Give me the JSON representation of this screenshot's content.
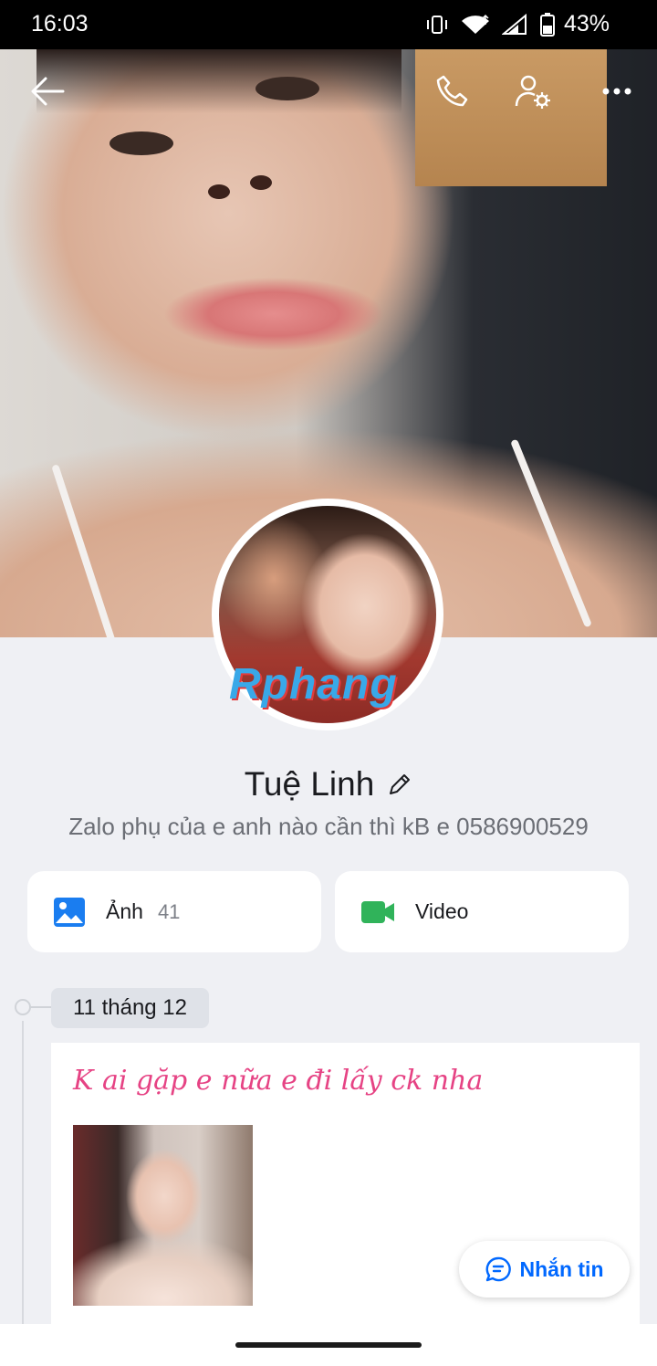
{
  "status_bar": {
    "time": "16:03",
    "battery": "43%",
    "icons": [
      "vibrate-icon",
      "wifi-icon",
      "signal-icon",
      "battery-icon"
    ]
  },
  "header": {
    "actions": [
      "back-icon",
      "phone-icon",
      "user-settings-icon",
      "more-icon"
    ]
  },
  "watermark": "Rphang",
  "profile": {
    "name": "Tuệ Linh",
    "bio": "Zalo phụ của e anh nào cần thì kB e 0586900529"
  },
  "media": {
    "photos_label": "Ảnh",
    "photos_count": "41",
    "video_label": "Video"
  },
  "timeline": {
    "date": "11 tháng 12",
    "post_text": "K ai gặp e nữa e đi lấy ck nha"
  },
  "message_button": {
    "label": "Nhắn tin"
  },
  "colors": {
    "accent": "#0068ff",
    "post_text": "#e64384",
    "background": "#eff0f4",
    "video_icon": "#30b35a"
  }
}
